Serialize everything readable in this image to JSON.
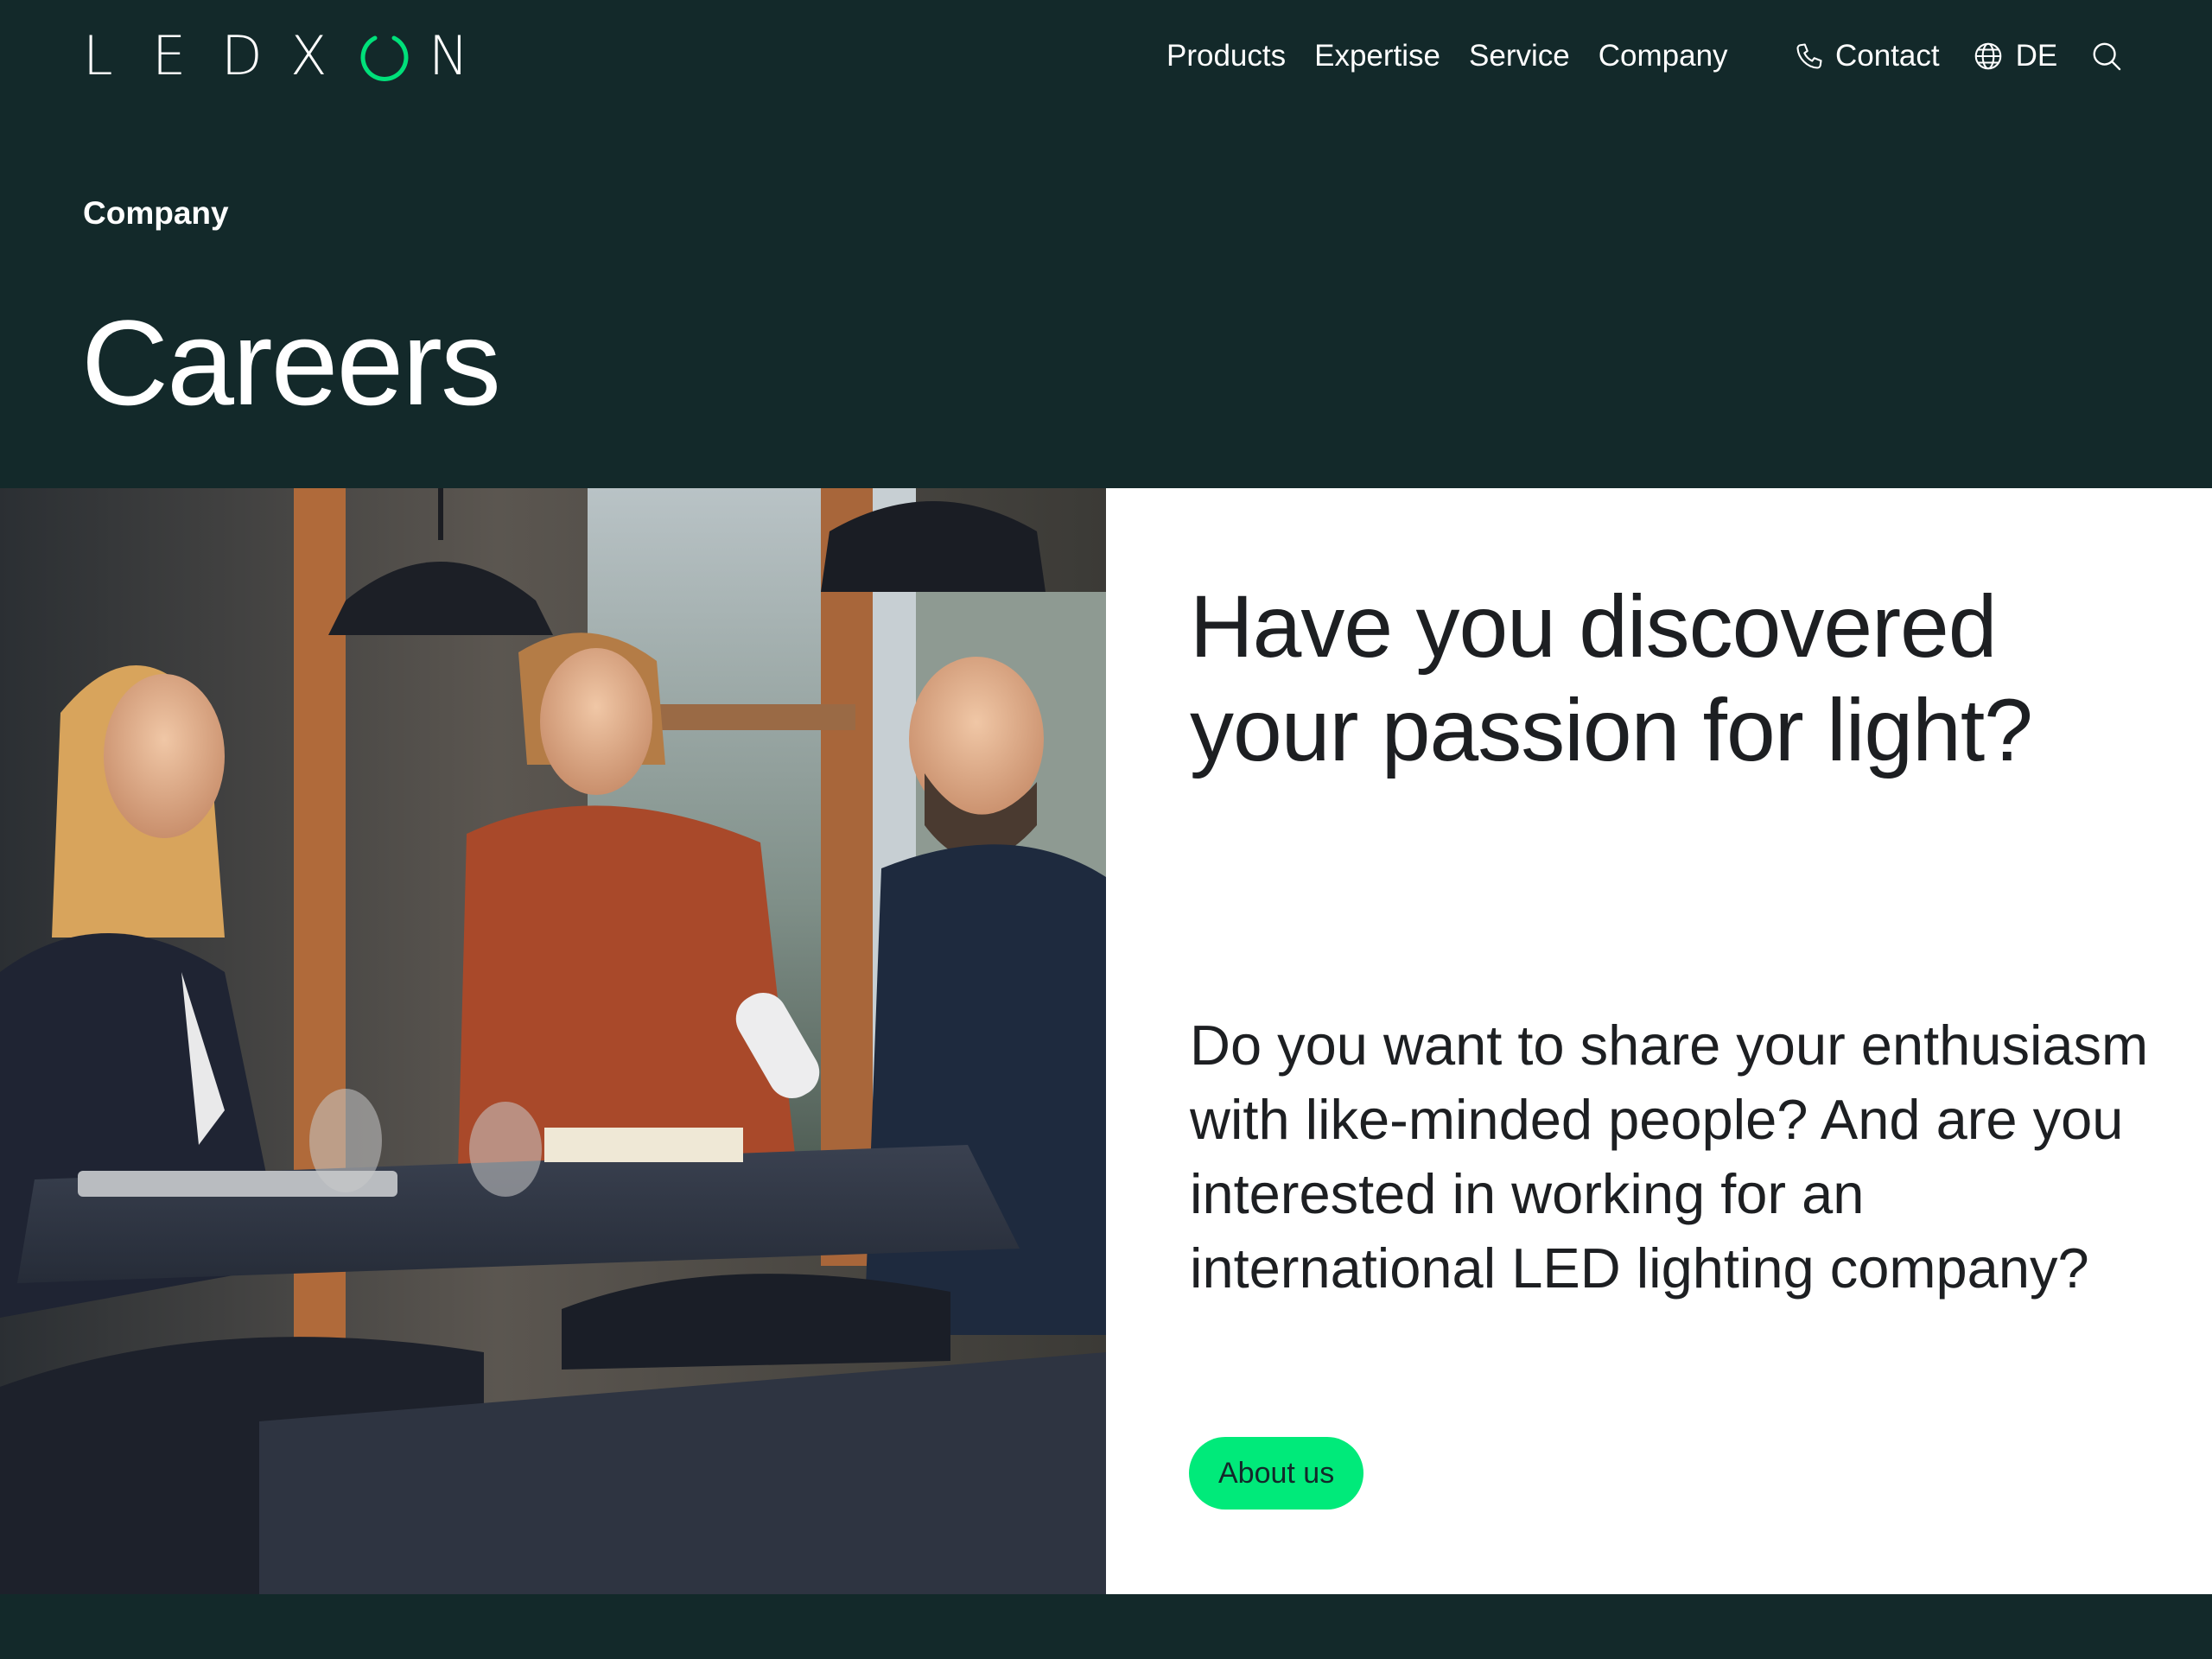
{
  "brand": {
    "logo_letters_before": [
      "L",
      "E",
      "D",
      "X"
    ],
    "logo_letters_after": [
      "N"
    ],
    "accent_color": "#00e07a",
    "background_color": "#13292a"
  },
  "nav": {
    "items": [
      {
        "label": "Products"
      },
      {
        "label": "Expertise"
      },
      {
        "label": "Service"
      },
      {
        "label": "Company"
      }
    ],
    "contact_label": "Contact",
    "contact_icon": "phone-icon",
    "language_label": "DE",
    "language_icon": "globe-icon",
    "search_icon": "search-icon"
  },
  "page": {
    "breadcrumb": "Company",
    "title": "Careers"
  },
  "section": {
    "image_icon": "office-photo",
    "headline": "Have you discovered your passion for light?",
    "body": "Do you want to share your enthusiasm with like-minded people? And are you interested in working for an international LED lighting company?",
    "button_label": "About us",
    "button_color": "#00ea7a"
  }
}
